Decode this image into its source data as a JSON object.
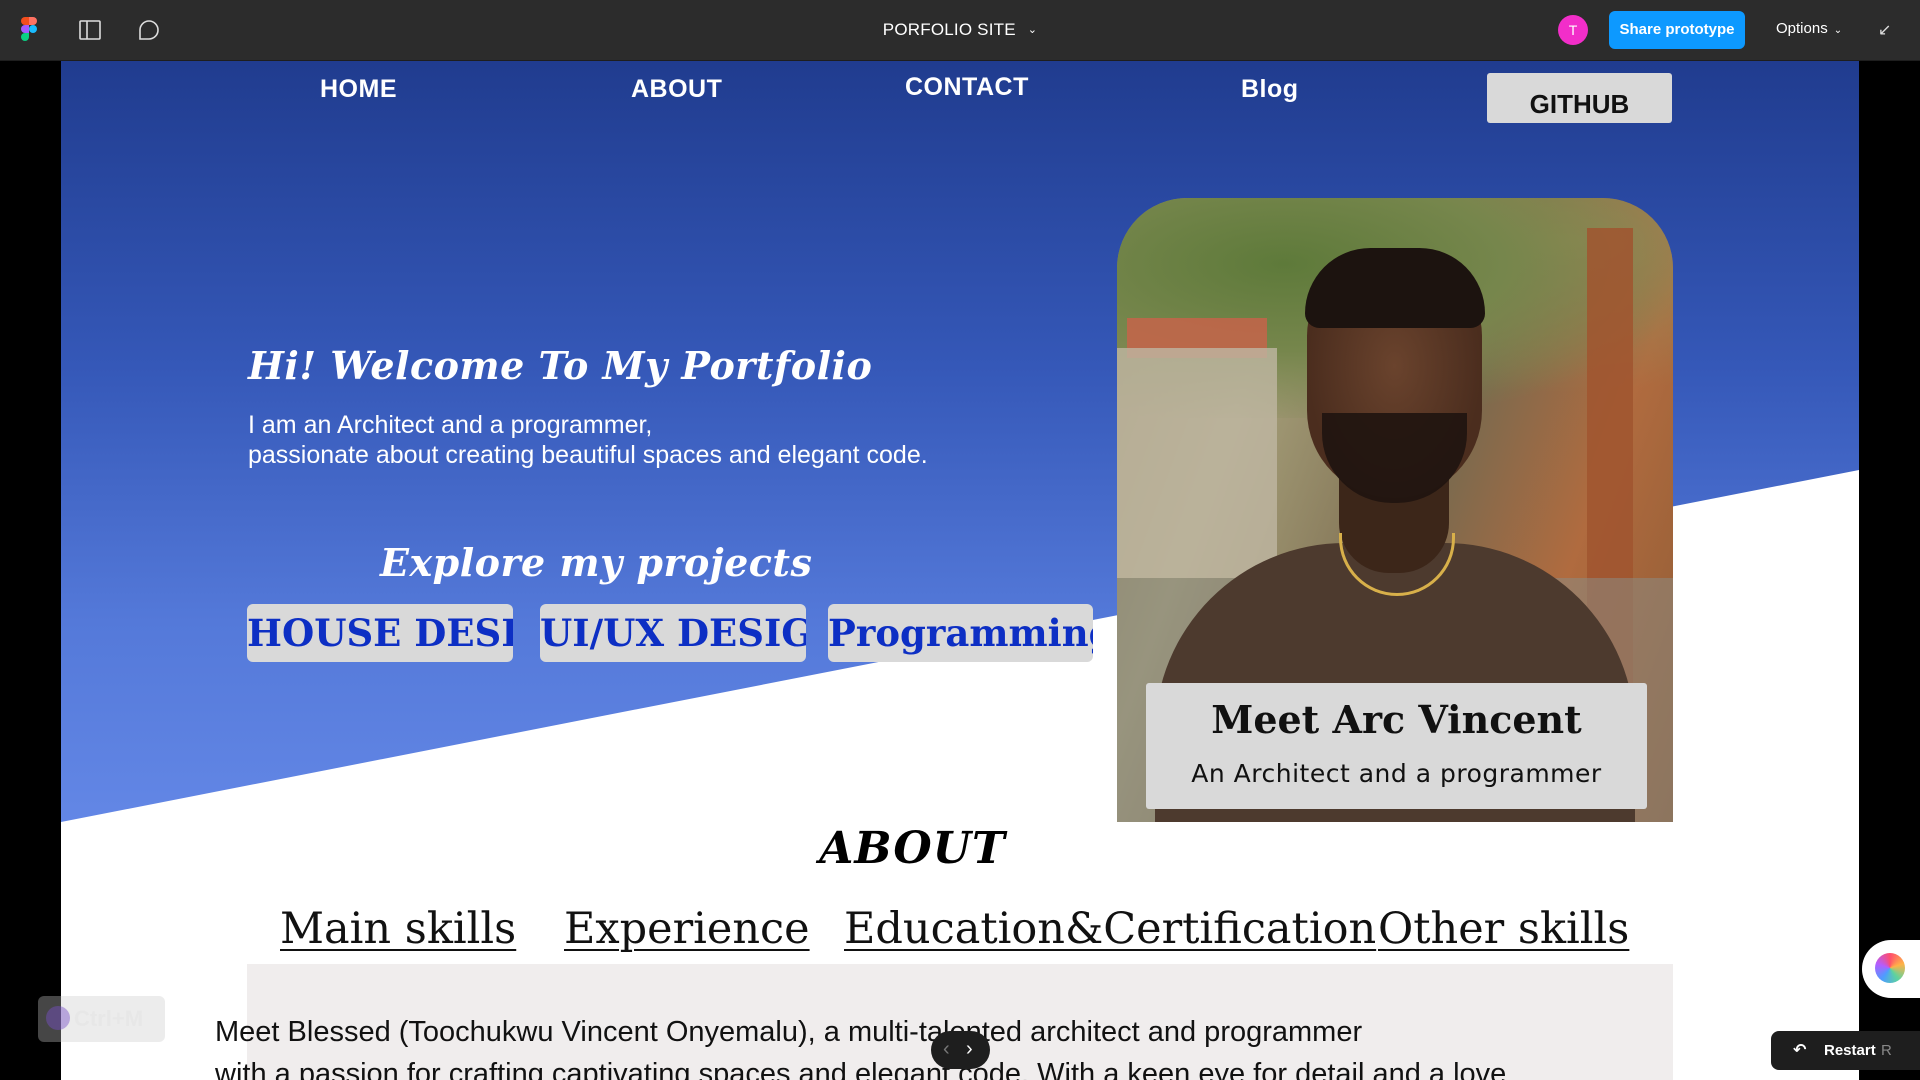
{
  "toolbar": {
    "title": "PORFOLIO SITE",
    "avatar_initial": "T",
    "share_label": "Share prototype",
    "options_label": "Options",
    "brand_color": "#0d99ff",
    "avatar_color": "#f22ec9"
  },
  "nav": {
    "home": "HOME",
    "about": "ABOUT",
    "contact": "CONTACT",
    "blog": "Blog",
    "github": "GITHUB"
  },
  "hero": {
    "title": "Hi! Welcome To My Portfolio",
    "subtitle_line1": "I am an Architect and a programmer,",
    "subtitle_line2": "passionate  about creating beautiful spaces and elegant code.",
    "explore": "Explore my projects",
    "projects": [
      "HOUSE DESIGN",
      "UI/UX DESIGN",
      "Programming"
    ]
  },
  "profile": {
    "name": "Meet Arc Vincent",
    "role": "An Architect and a programmer"
  },
  "about": {
    "title": "ABOUT",
    "tabs": [
      "Main skills",
      "Experience",
      "Education&Certification",
      "Other skills"
    ],
    "text_line1": "Meet Blessed (Toochukwu Vincent Onyemalu), a multi-talented architect and programmer",
    "text_line2": "with a passion for crafting captivating spaces and elegant code. With a keen eye for detail and a love"
  },
  "overlays": {
    "shortcut": "Ctrl+M",
    "restart_label": "Restart",
    "restart_key": "R"
  }
}
